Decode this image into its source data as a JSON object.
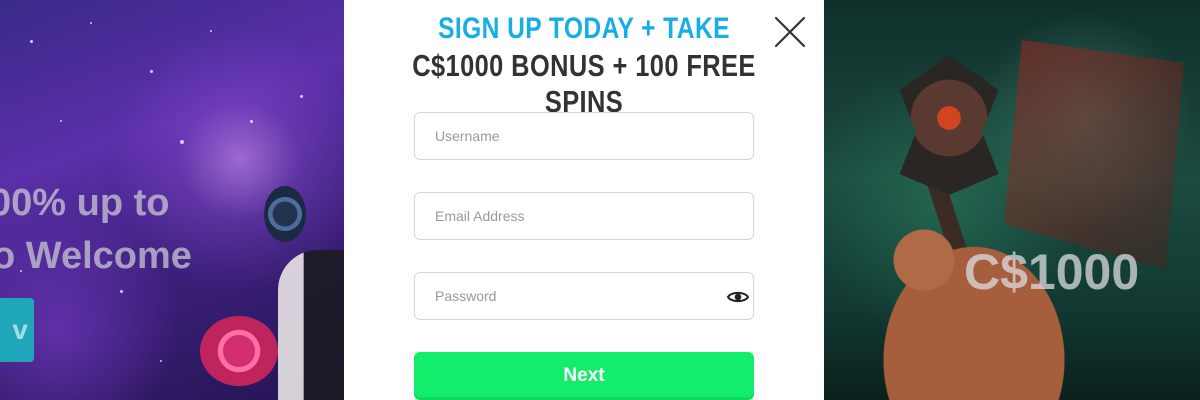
{
  "background_left": {
    "promo_line_1": "00% up to",
    "promo_line_2": "o Welcome",
    "button_fragment": "v"
  },
  "background_right": {
    "promo_text": "C$1000"
  },
  "modal": {
    "title_line_1": "SIGN UP TODAY + TAKE",
    "title_line_2": "C$1000 BONUS + 100 FREE SPINS",
    "close_icon": "close-icon",
    "fields": {
      "username_placeholder": "Username",
      "email_placeholder": "Email Address",
      "password_placeholder": "Password",
      "password_toggle_icon": "eye-icon"
    },
    "next_label": "Next"
  },
  "colors": {
    "title_accent": "#17aee6",
    "title_dark": "#333333",
    "next_button": "#14ec6c"
  }
}
